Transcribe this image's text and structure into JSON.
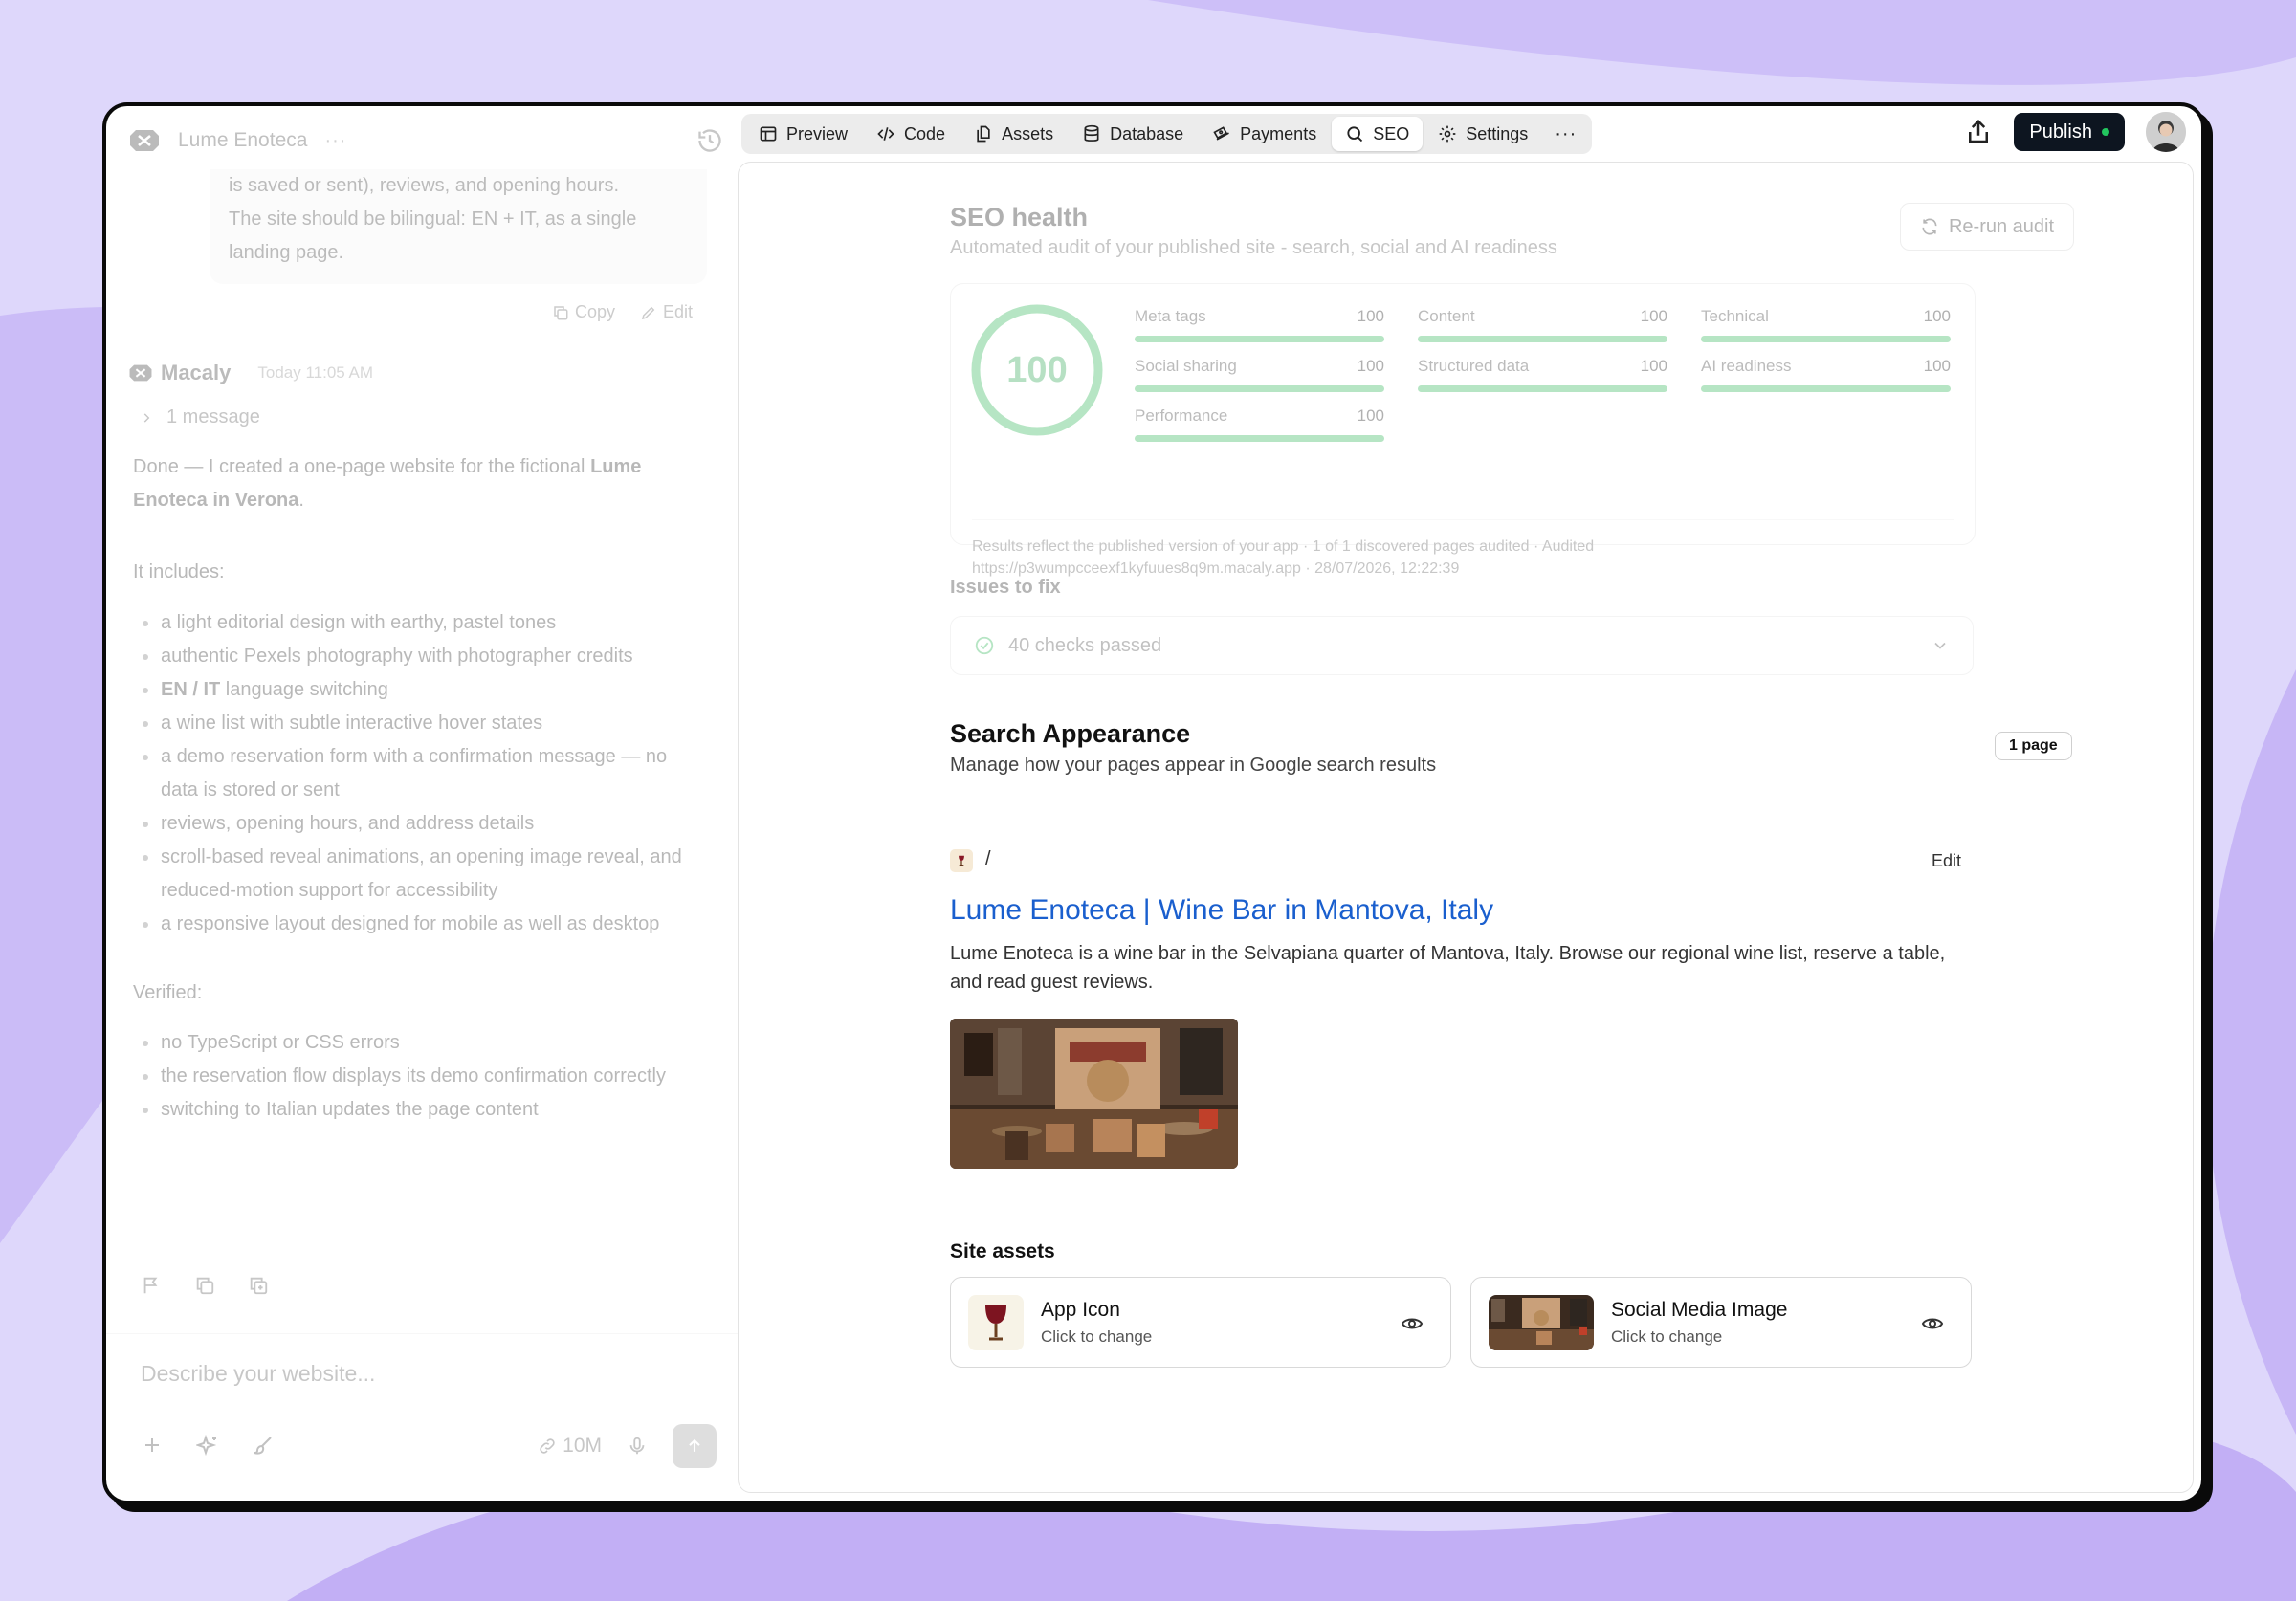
{
  "app": {
    "project_name": "Lume Enoteca",
    "project_more": "···"
  },
  "chat": {
    "prompt_lines": [
      "is saved or sent), reviews, and opening hours.",
      "The site should be bilingual: EN + IT, as a single",
      "landing page."
    ],
    "copy_label": "Copy",
    "edit_label": "Edit",
    "author": "Macaly",
    "time": "Today 11:05 AM",
    "thread_count": "1 message",
    "intro_start": "Done — I created a one-page website for the fictional ",
    "intro_bold": "Lume Enoteca in Verona",
    "intro_end": ".",
    "includes_label": "It includes:",
    "include_items": [
      "a light editorial design with earthy, pastel tones",
      "authentic Pexels photography with photographer credits",
      "language switching",
      "a wine list with subtle interactive hover states",
      "a demo reservation form with a confirmation message — no data is stored or sent",
      "reviews, opening hours, and address details",
      "scroll-based reveal animations, an opening image reveal, and reduced-motion support for accessibility",
      "a responsive layout designed for mobile as well as desktop"
    ],
    "lang_bold": "EN / IT",
    "verified_label": "Verified:",
    "verified_items": [
      "no TypeScript or CSS errors",
      "the reservation flow displays its demo confirmation correctly",
      "switching to Italian updates the page content"
    ],
    "composer_placeholder": "Describe your website...",
    "token_count": "10M"
  },
  "toolbar": {
    "tabs": [
      "Preview",
      "Code",
      "Assets",
      "Database",
      "Payments",
      "SEO",
      "Settings"
    ],
    "active_tab": "SEO",
    "more": "···",
    "publish_label": "Publish"
  },
  "seo": {
    "title": "SEO health",
    "subtitle": "Automated audit of your published site - search, social and AI readiness",
    "rerun_label": "Re-run audit",
    "score": "100",
    "metrics": [
      {
        "label": "Meta tags",
        "value": "100"
      },
      {
        "label": "Content",
        "value": "100"
      },
      {
        "label": "Technical",
        "value": "100"
      },
      {
        "label": "Social sharing",
        "value": "100"
      },
      {
        "label": "Structured data",
        "value": "100"
      },
      {
        "label": "AI readiness",
        "value": "100"
      },
      {
        "label": "Performance",
        "value": "100"
      }
    ],
    "footer_line1": "Results reflect the published version of your app · 1 of 1 discovered pages audited · Audited",
    "footer_line2": "https://p3wumpcceexf1kyfuues8q9m.macaly.app · 28/07/2026, 12:22:39",
    "issues_label": "Issues to fix",
    "checks_passed": "40 checks passed"
  },
  "search_appearance": {
    "title": "Search Appearance",
    "subtitle": "Manage how your pages appear in Google search results",
    "badge": "1 page",
    "path": "/",
    "edit_label": "Edit",
    "result_title": "Lume Enoteca | Wine Bar in Mantova, Italy",
    "result_desc": "Lume Enoteca is a wine bar in the Selvapiana quarter of Mantova, Italy. Browse our regional wine list, reserve a table, and read guest reviews."
  },
  "site_assets": {
    "title": "Site assets",
    "items": [
      {
        "name": "App Icon",
        "sub": "Click to change"
      },
      {
        "name": "Social Media Image",
        "sub": "Click to change"
      }
    ]
  },
  "colors": {
    "accent_green": "#22b14c",
    "link_blue": "#1a5fce",
    "publish_bg": "#0d1520",
    "background_purple": "#ddd5fb"
  }
}
